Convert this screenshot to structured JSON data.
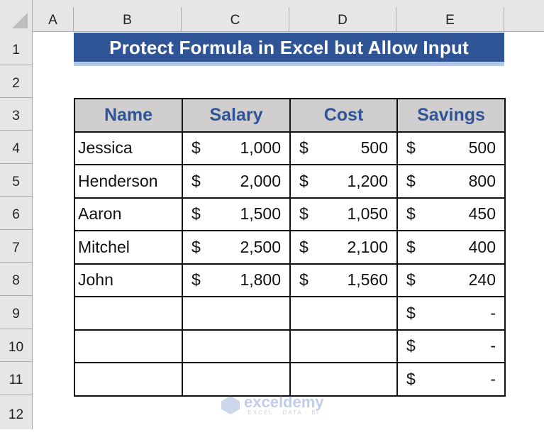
{
  "columns": [
    "A",
    "B",
    "C",
    "D",
    "E"
  ],
  "rows": [
    "1",
    "2",
    "3",
    "4",
    "5",
    "6",
    "7",
    "8",
    "9",
    "10",
    "11",
    "12"
  ],
  "title": "Protect Formula in Excel but Allow Input",
  "table": {
    "headers": [
      "Name",
      "Salary",
      "Cost",
      "Savings"
    ],
    "currency_symbol": "$",
    "records": [
      {
        "name": "Jessica",
        "salary": "1,000",
        "cost": "500",
        "savings": "500"
      },
      {
        "name": "Henderson",
        "salary": "2,000",
        "cost": "1,200",
        "savings": "800"
      },
      {
        "name": "Aaron",
        "salary": "1,500",
        "cost": "1,050",
        "savings": "450"
      },
      {
        "name": "Mitchel",
        "salary": "2,500",
        "cost": "2,100",
        "savings": "400"
      },
      {
        "name": "John",
        "salary": "1,800",
        "cost": "1,560",
        "savings": "240"
      },
      {
        "name": "",
        "salary": "",
        "cost": "",
        "savings": "-"
      },
      {
        "name": "",
        "salary": "",
        "cost": "",
        "savings": "-"
      },
      {
        "name": "",
        "salary": "",
        "cost": "",
        "savings": "-"
      }
    ]
  },
  "watermark": {
    "brand": "exceldemy",
    "tagline": "EXCEL · DATA · BI"
  },
  "colors": {
    "title_bg": "#2f5597",
    "header_bg": "#d0cece",
    "header_text": "#2f5597"
  }
}
